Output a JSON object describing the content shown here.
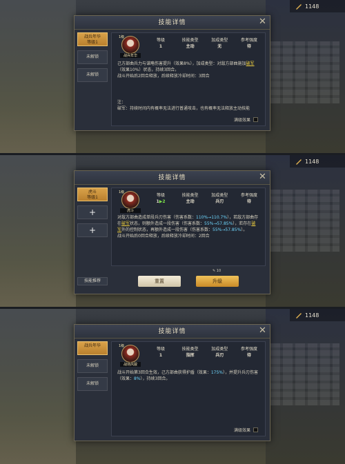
{
  "currency": "1148",
  "title": "技能详情",
  "labels": {
    "level": "等级",
    "type": "技能类型",
    "bonus": "加成类型",
    "reference": "参考强度"
  },
  "max_effect_label": "满级效果",
  "reset_label": "重置",
  "upgrade_label": "升级",
  "recommend_label": "技能推荐",
  "upgrade_cost": "10",
  "panels": [
    {
      "side": [
        {
          "name": "战兵年华",
          "sub": "等级1"
        },
        {
          "name": "未解锁"
        },
        {
          "name": "未解锁"
        }
      ],
      "avatar_lv": "1级",
      "avatar_name": "战兵年华",
      "level": "1",
      "type": "主动",
      "bonus": "无",
      "reference": "待",
      "text1": "己方部曲兵力与谋略伤害提升（效果8%），加成类型：对敌方部曲施加",
      "text1_u": "破军",
      "text1_b": "（效果10%）状态，持续3回合。",
      "text2": "战斗开始后2回合释放，后续释放冷却时间：3回合",
      "note_a": "注：",
      "note_b": "破军：持续时间内有概率无法进行普通攻击，也有概率无法释放主动技能"
    },
    {
      "side": [
        {
          "name": "虎斗",
          "sub": "等级1"
        },
        {
          "name": "+"
        },
        {
          "name": "+"
        }
      ],
      "avatar_lv": "1级",
      "avatar_name": "虎斗",
      "level": "1",
      "level_next": "2",
      "type": "主动",
      "bonus": "兵刃",
      "reference": "待",
      "text1a": "对敌方部曲造成单段兵刃伤害（伤害系数：",
      "text1a_hl": "110%→110.7%",
      "text1a_b": "），若敌方部曲存在",
      "text1b_u": "破军",
      "text1b": "状态，则额外造成一段伤害（伤害系数：",
      "text1b_hl": "55%→57.85%",
      "text1b_c": "），若存在",
      "text1c_u": "破军",
      "text1c": "外的控制状态，再额外造成一段伤害（伤害系数：",
      "text1c_hl": "55%→57.85%",
      "text1c_b": "）。",
      "text2": "战斗开始后0回合释放，后续释放冷却时间：2回合"
    },
    {
      "side": [
        {
          "name": "战兵年华",
          "sub": ""
        },
        {
          "name": "未解锁"
        },
        {
          "name": "未解锁"
        }
      ],
      "avatar_lv": "1级",
      "avatar_name": "战场风骏",
      "level": "1",
      "type": "指挥",
      "bonus": "兵刃",
      "reference": "待",
      "text1": "战斗开始第3回合生效，己方部曲获得护盾（效果：",
      "text1_hl": "175%",
      "text1_b": "），并提升兵刃伤害（效果：",
      "text1_hl2": "8%",
      "text1_c": "），持续3回合。"
    }
  ]
}
